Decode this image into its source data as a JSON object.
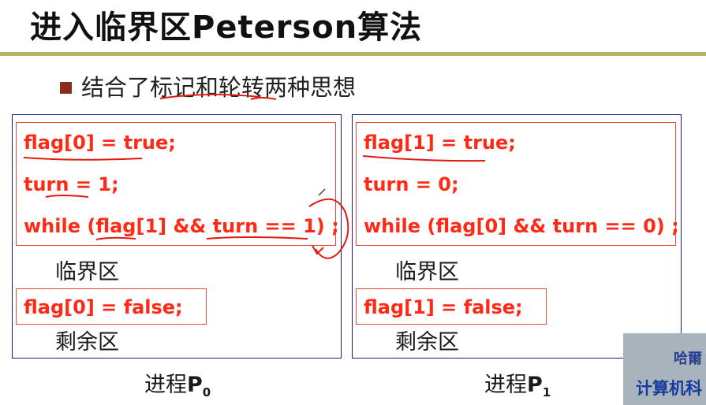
{
  "slide": {
    "title": "进入临界区Peterson算法",
    "bullet": "结合了标记和轮转两种思想"
  },
  "p0": {
    "lines": [
      "flag[0] = true;",
      "turn = 1;",
      "while (flag[1] && turn == 1) ;"
    ],
    "critical": "临界区",
    "exit": "flag[0] = false;",
    "remainder": "剩余区",
    "label_prefix": "进程",
    "label_p": "P",
    "label_sub": "0"
  },
  "p1": {
    "lines": [
      "flag[1] = true;",
      "turn = 0;",
      "while (flag[0] && turn == 0) ;"
    ],
    "critical": "临界区",
    "exit": "flag[1] = false;",
    "remainder": "剩余区",
    "label_prefix": "进程",
    "label_p": "P",
    "label_sub": "1"
  },
  "watermark": {
    "line1": "哈爾",
    "line2": "计算机科"
  },
  "colors": {
    "code_red": "#ff2a16",
    "box_blue": "#1b1b7a",
    "rule_olive": "#b7b26a",
    "bullet_brown": "#8b2d1a"
  }
}
